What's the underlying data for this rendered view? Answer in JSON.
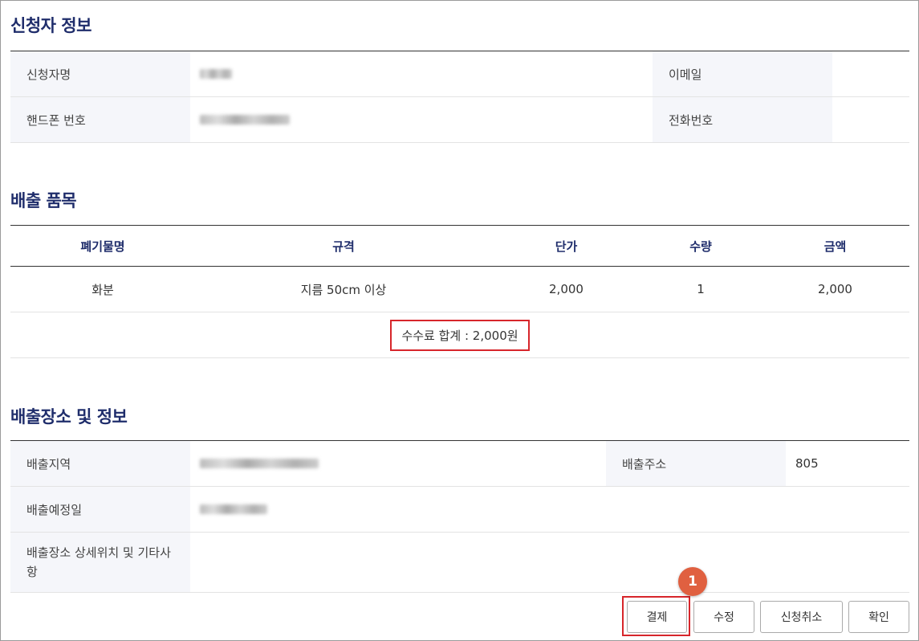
{
  "applicant": {
    "title": "신청자 정보",
    "name_label": "신청자명",
    "email_label": "이메일",
    "phone_label": "핸드폰 번호",
    "tel_label": "전화번호"
  },
  "items": {
    "title": "배출 품목",
    "headers": [
      "폐기물명",
      "규격",
      "단가",
      "수량",
      "금액"
    ],
    "rows": [
      [
        "화분",
        "지름 50cm 이상",
        "2,000",
        "1",
        "2,000"
      ]
    ],
    "total_text": "수수료 합계 : 2,000원"
  },
  "location": {
    "title": "배출장소 및 정보",
    "region_label": "배출지역",
    "address_label": "배출주소",
    "address_value": "805",
    "date_label": "배출예정일",
    "detail_label": "배출장소 상세위치 및 기타사항"
  },
  "buttons": {
    "pay": "결제",
    "edit": "수정",
    "cancel": "신청취소",
    "confirm": "확인"
  },
  "badge": "1",
  "colors": {
    "title": "#1f2d6b",
    "highlight": "#d7262b",
    "badge": "#e06040"
  }
}
